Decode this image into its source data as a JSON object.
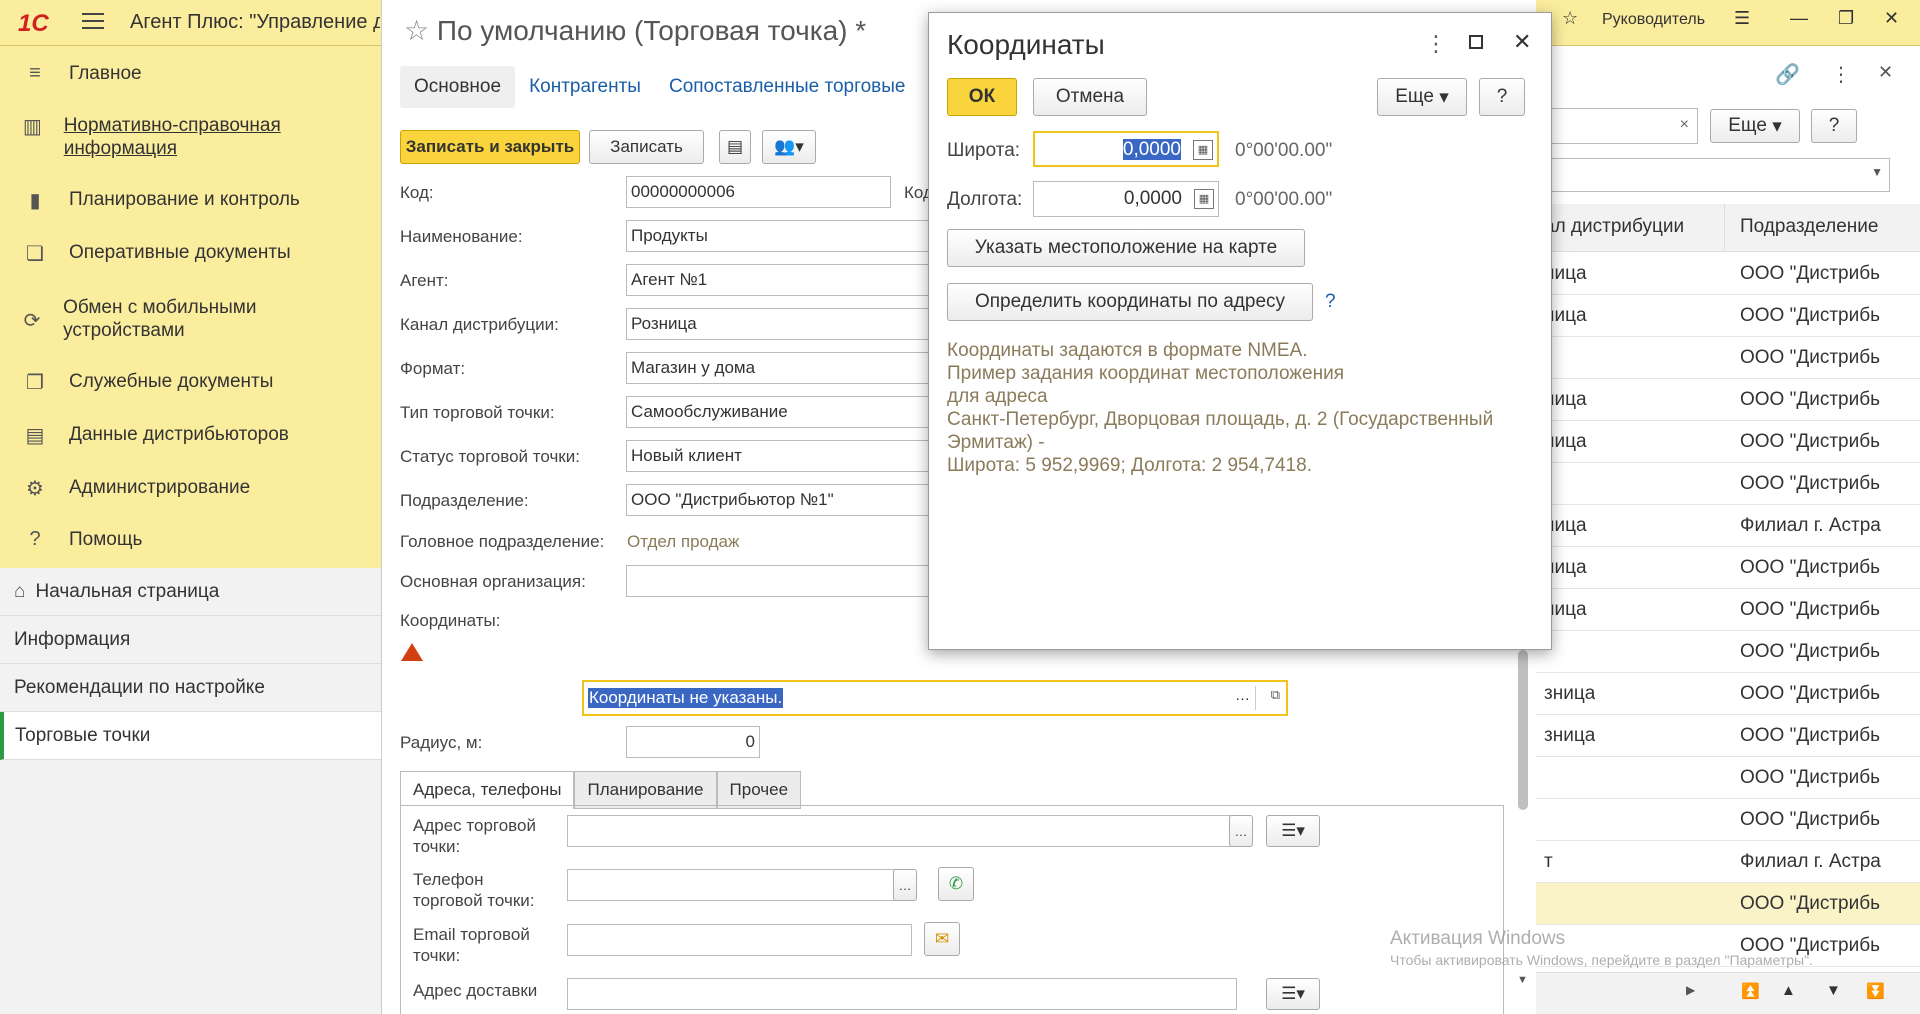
{
  "topbar": {
    "logo": "1С",
    "app_title": "Агент Плюс: \"Управление д",
    "user": "Руководитель"
  },
  "sidebar": {
    "items": [
      {
        "label": "Главное",
        "icon": "menu-icon"
      },
      {
        "label": "Нормативно-справочная информация",
        "icon": "catalog-icon"
      },
      {
        "label": "Планирование и контроль",
        "icon": "chart-icon"
      },
      {
        "label": "Оперативные документы",
        "icon": "documents-icon"
      },
      {
        "label": "Обмен с мобильными устройствами",
        "icon": "sync-icon"
      },
      {
        "label": "Служебные документы",
        "icon": "service-docs-icon"
      },
      {
        "label": "Данные дистрибьюторов",
        "icon": "distributor-data-icon"
      },
      {
        "label": "Администрирование",
        "icon": "gear-icon"
      },
      {
        "label": "Помощь",
        "icon": "help-icon"
      }
    ],
    "lower": [
      {
        "label": "Начальная страница",
        "icon": "home-icon"
      },
      {
        "label": "Информация"
      },
      {
        "label": "Рекомендации по настройке"
      },
      {
        "label": "Торговые точки"
      }
    ]
  },
  "form": {
    "title": "По умолчанию (Торговая точка) *",
    "tabs": [
      "Основное",
      "Контрагенты",
      "Сопоставленные торговые"
    ],
    "save_close": "Записать и закрыть",
    "save": "Записать",
    "labels": {
      "code": "Код:",
      "code2": "Код",
      "name": "Наименование:",
      "agent": "Агент:",
      "channel": "Канал дистрибуции:",
      "format": "Формат:",
      "type": "Тип торговой точки:",
      "status": "Статус торговой точки:",
      "division": "Подразделение:",
      "head_division": "Головное подразделение:",
      "main_org": "Основная организация:",
      "coords": "Координаты:",
      "radius": "Радиус, м:"
    },
    "values": {
      "code": "00000000006",
      "name": "Продукты",
      "agent": "Агент №1",
      "channel": "Розница",
      "format": "Магазин у дома",
      "type": "Самообслуживание",
      "status": "Новый клиент",
      "division": "ООО \"Дистрибьютор №1\"",
      "head_division": "Отдел продаж",
      "main_org": "",
      "coords": "Координаты не указаны.",
      "radius": "0"
    },
    "subtabs": [
      "Адреса, телефоны",
      "Планирование",
      "Прочее"
    ],
    "sub_labels": {
      "address": "Адрес торговой точки:",
      "phone": "Телефон торговой точки:",
      "email": "Email торговой точки:",
      "delivery": "Адрес доставки"
    }
  },
  "rlist": {
    "more": "Еще",
    "help": "?",
    "col1": "ал дистрибуции",
    "col2": "Подразделение",
    "rows": [
      [
        "ница",
        "ООО \"Дистрибь"
      ],
      [
        "ница",
        "ООО \"Дистрибь"
      ],
      [
        "",
        "ООО \"Дистрибь"
      ],
      [
        "ница",
        "ООО \"Дистрибь"
      ],
      [
        "ница",
        "ООО \"Дистрибь"
      ],
      [
        "",
        "ООО \"Дистрибь"
      ],
      [
        "ница",
        "Филиал г. Астра"
      ],
      [
        "ница",
        "ООО \"Дистрибь"
      ],
      [
        "ница",
        "ООО \"Дистрибь"
      ],
      [
        "",
        "ООО \"Дистрибь"
      ],
      [
        "зница",
        "ООО \"Дистрибь"
      ],
      [
        "зница",
        "ООО \"Дистрибь"
      ],
      [
        "",
        "ООО \"Дистрибь"
      ],
      [
        "",
        "ООО \"Дистрибь"
      ],
      [
        "т",
        "Филиал г. Астра"
      ],
      [
        "",
        "ООО \"Дистрибь"
      ],
      [
        "",
        "ООО \"Дистрибь"
      ]
    ]
  },
  "dialog": {
    "title": "Координаты",
    "ok": "ОК",
    "cancel": "Отмена",
    "more": "Еще",
    "help": "?",
    "lat_label": "Широта:",
    "lat_value": "0,0000",
    "lat_dms": "0°00'00.00\"",
    "lon_label": "Долгота:",
    "lon_value": "0,0000",
    "lon_dms": "0°00'00.00\"",
    "map_button": "Указать местоположение на карте",
    "addr_button": "Определить координаты по адресу",
    "addr_help": "?",
    "info_lines": [
      "Координаты задаются в формате NMEA.",
      "Пример задания координат местоположения",
      "для адреса",
      "Санкт-Петербург, Дворцовая площадь, д. 2 (Государственный",
      "Эрмитаж) -",
      "Широта: 5 952,9969; Долгота: 2 954,7418."
    ]
  },
  "watermark": {
    "line1": "Активация Windows",
    "line2": "Чтобы активировать Windows, перейдите в раздел \"Параметры\"."
  },
  "colors": {
    "accent_yellow": "#f9d43c",
    "sidebar_bg": "#fbed9e",
    "link": "#1a5ea8",
    "hint": "#8a7b5a"
  }
}
